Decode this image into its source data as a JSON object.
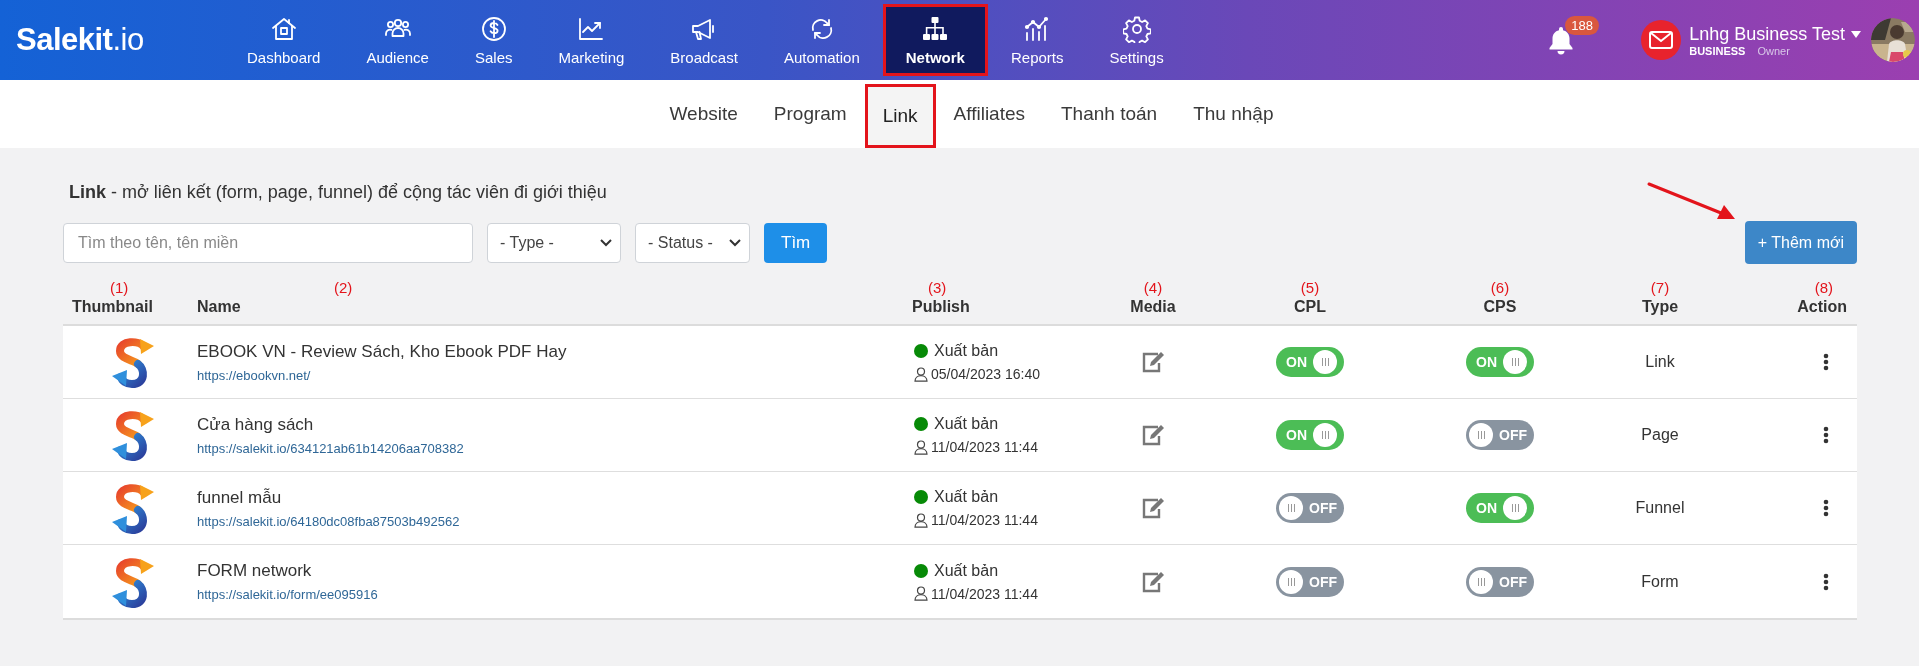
{
  "header": {
    "logo": {
      "name": "Salekit",
      "suffix": ".io"
    },
    "nav": [
      {
        "label": "Dashboard",
        "selected": false,
        "highlighted": false
      },
      {
        "label": "Audience",
        "selected": false,
        "highlighted": false
      },
      {
        "label": "Sales",
        "selected": false,
        "highlighted": false
      },
      {
        "label": "Marketing",
        "selected": false,
        "highlighted": false
      },
      {
        "label": "Broadcast",
        "selected": false,
        "highlighted": false
      },
      {
        "label": "Automation",
        "selected": false,
        "highlighted": false
      },
      {
        "label": "Network",
        "selected": true,
        "highlighted": true
      },
      {
        "label": "Reports",
        "selected": false,
        "highlighted": false
      },
      {
        "label": "Settings",
        "selected": false,
        "highlighted": false
      }
    ],
    "notifications": {
      "count": "188"
    },
    "account": {
      "name": "Lnhg Business Test",
      "plan": "BUSINESS",
      "role": "Owner"
    }
  },
  "subnav": [
    {
      "label": "Website",
      "selected": false,
      "highlighted": false
    },
    {
      "label": "Program",
      "selected": false,
      "highlighted": false
    },
    {
      "label": "Link",
      "selected": true,
      "highlighted": true
    },
    {
      "label": "Affiliates",
      "selected": false,
      "highlighted": false
    },
    {
      "label": "Thanh toán",
      "selected": false,
      "highlighted": false
    },
    {
      "label": "Thu nhập",
      "selected": false,
      "highlighted": false
    }
  ],
  "page": {
    "description": "**Link** - mở liên kết (form, page, funnel) để cộng tác viên đi giới thiệu"
  },
  "filters": {
    "search": {
      "placeholder": "Tìm theo tên, tên miền"
    },
    "type": "- Type -",
    "status": "- Status -",
    "submit": "Tìm"
  },
  "add_button": {
    "label": "+ Thêm mới",
    "pointer_arrow": true
  },
  "table": {
    "columns": [
      {
        "label": "Thumbnail",
        "marker": "(1)"
      },
      {
        "label": "Name",
        "marker": "(2)"
      },
      {
        "label": "Publish",
        "marker": "(3)"
      },
      {
        "label": "Media",
        "marker": "(4)"
      },
      {
        "label": "CPL",
        "marker": "(5)"
      },
      {
        "label": "CPS",
        "marker": "(6)"
      },
      {
        "label": "Type",
        "marker": "(7)"
      },
      {
        "label": "Action",
        "marker": "(8)"
      }
    ],
    "rows": [
      {
        "name": "EBOOK VN - Review Sách, Kho Ebook PDF Hay",
        "url": "https://ebookvn.net/",
        "status": "Xuất bản",
        "published": "05/04/2023 16:40",
        "cpl": {
          "on": true,
          "label": "ON"
        },
        "cps": {
          "on": true,
          "label": "ON"
        },
        "type": "Link"
      },
      {
        "name": "Cửa hàng sách",
        "url": "https://salekit.io/634121ab61b14206aa708382",
        "status": "Xuất bản",
        "published": "11/04/2023 11:44",
        "cpl": {
          "on": true,
          "label": "ON"
        },
        "cps": {
          "on": false,
          "label": "OFF"
        },
        "type": "Page"
      },
      {
        "name": "funnel mẫu",
        "url": "https://salekit.io/64180dc08fba87503b492562",
        "status": "Xuất bản",
        "published": "11/04/2023 11:44",
        "cpl": {
          "on": false,
          "label": "OFF"
        },
        "cps": {
          "on": true,
          "label": "ON"
        },
        "type": "Funnel"
      },
      {
        "name": "FORM network",
        "url": "https://salekit.io/form/ee095916",
        "status": "Xuất bản",
        "published": "11/04/2023 11:44",
        "cpl": {
          "on": false,
          "label": "OFF"
        },
        "cps": {
          "on": false,
          "label": "OFF"
        },
        "type": "Form"
      }
    ]
  }
}
